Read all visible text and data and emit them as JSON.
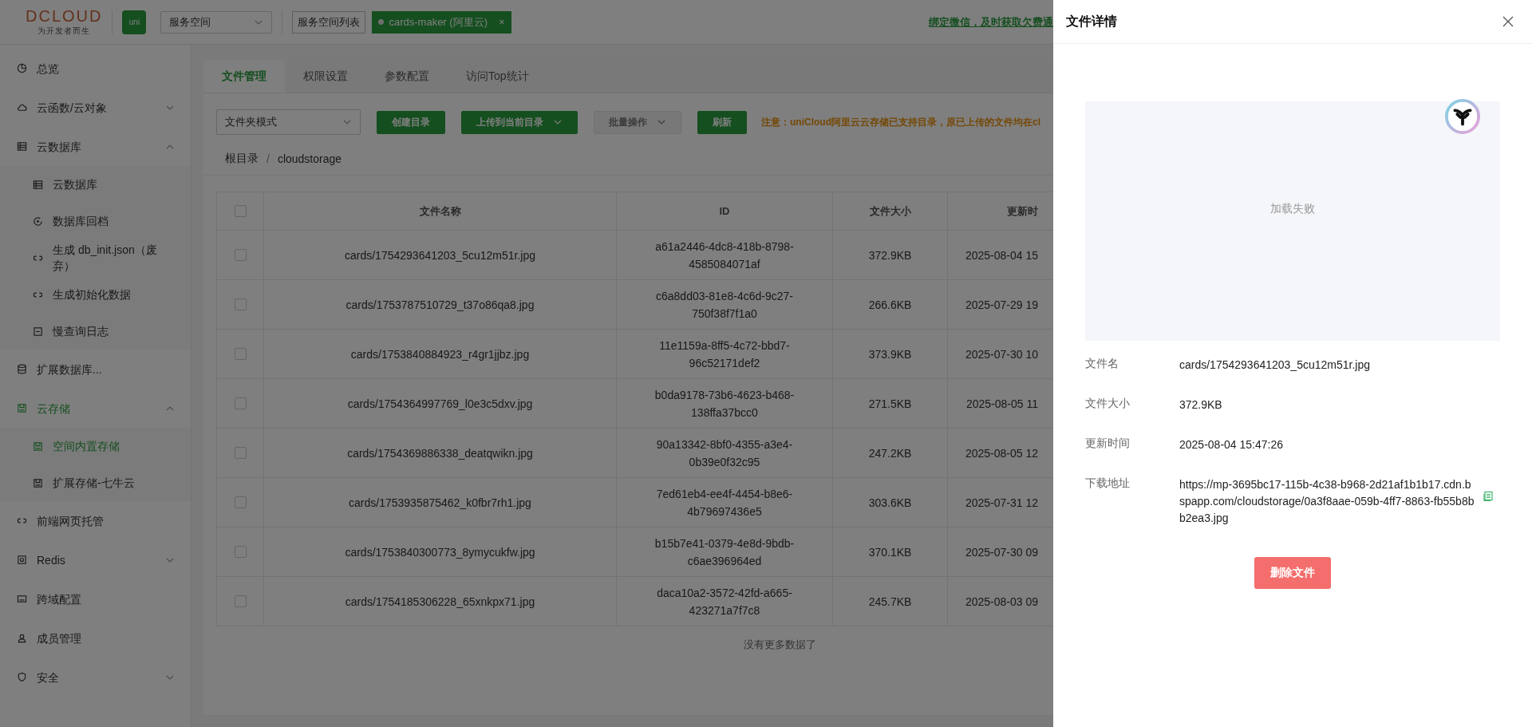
{
  "header": {
    "logo": {
      "name": "DCLOUD",
      "slogan": "为开发者而生"
    },
    "app_badge": "uni",
    "space_select": {
      "value": "服务空间"
    },
    "space_list_button": "服务空间列表",
    "space_tag": {
      "label": "cards-maker (阿里云)",
      "close": "×"
    },
    "notice_link": "绑定微信，及时获取欠费通"
  },
  "sidebar": {
    "items": [
      {
        "label": "总览",
        "selected": false
      },
      {
        "label": "云函数/云对象",
        "selected": false,
        "expanded": false
      },
      {
        "label": "云数据库",
        "selected": false,
        "expanded": true,
        "children": [
          {
            "label": "云数据库",
            "selected": false
          },
          {
            "label": "数据库回档",
            "selected": false
          },
          {
            "label": "生成 db_init.json（废弃）",
            "selected": false
          },
          {
            "label": "生成初始化数据",
            "selected": false
          },
          {
            "label": "慢查询日志",
            "selected": false
          }
        ]
      },
      {
        "label": "扩展数据库...",
        "selected": false
      },
      {
        "label": "云存储",
        "selected": false,
        "expanded": true,
        "children": [
          {
            "label": "空间内置存储",
            "selected": true
          },
          {
            "label": "扩展存储-七牛云",
            "selected": false
          }
        ]
      },
      {
        "label": "前端网页托管",
        "selected": false
      },
      {
        "label": "Redis",
        "selected": false,
        "expanded": false
      },
      {
        "label": "跨域配置",
        "selected": false
      },
      {
        "label": "成员管理",
        "selected": false
      },
      {
        "label": "安全",
        "selected": false,
        "expanded": false
      }
    ]
  },
  "tabs": [
    {
      "label": "文件管理",
      "selected": true
    },
    {
      "label": "权限设置",
      "selected": false
    },
    {
      "label": "参数配置",
      "selected": false
    },
    {
      "label": "访问Top统计",
      "selected": false
    }
  ],
  "toolbar": {
    "mode_select": {
      "value": "文件夹模式"
    },
    "buttons": [
      {
        "label": "创建目录",
        "kind": "plain",
        "disabled": false
      },
      {
        "label": "上传到当前目录",
        "kind": "dropdown",
        "disabled": false
      },
      {
        "label": "批量操作",
        "kind": "dropdown",
        "disabled": true
      },
      {
        "label": "刷新",
        "kind": "plain",
        "disabled": false
      }
    ],
    "notice": "注意：uniCloud阿里云云存储已支持目录，原已上传的文件均在cl"
  },
  "breadcrumb": {
    "items": [
      "根目录",
      "cloudstorage"
    ],
    "separator": "/"
  },
  "table": {
    "select_all": {
      "checked": false
    },
    "columns": [
      "文件名称",
      "ID",
      "文件大小",
      "更新时"
    ],
    "rows": [
      {
        "checked": false,
        "name": "cards/1754293641203_5cu12m51r.jpg",
        "id": "a61a2446-4dc8-418b-8798-4585084071af",
        "size": "372.9KB",
        "time": "2025-08-04 15"
      },
      {
        "checked": false,
        "name": "cards/1753787510729_t37o86qa8.jpg",
        "id": "c6a8dd03-81e8-4c6d-9c27-750f38f7f1a0",
        "size": "266.6KB",
        "time": "2025-07-29 19"
      },
      {
        "checked": false,
        "name": "cards/1753840884923_r4gr1jjbz.jpg",
        "id": "11e1159a-8ff5-4c72-bbd7-96c52171def2",
        "size": "373.9KB",
        "time": "2025-07-30 10"
      },
      {
        "checked": false,
        "name": "cards/1754364997769_l0e3c5dxv.jpg",
        "id": "b0da9178-73b6-4623-b468-138ffa37bcc0",
        "size": "271.5KB",
        "time": "2025-08-05 11"
      },
      {
        "checked": false,
        "name": "cards/1754369886338_deatqwikn.jpg",
        "id": "90a13342-8bf0-4355-a3e4-0b39e0f32c95",
        "size": "247.2KB",
        "time": "2025-08-05 12"
      },
      {
        "checked": false,
        "name": "cards/1753935875462_k0fbr7rh1.jpg",
        "id": "7ed61eb4-ee4f-4454-b8e6-4b79697436e5",
        "size": "303.6KB",
        "time": "2025-07-31 12"
      },
      {
        "checked": false,
        "name": "cards/1753840300773_8ymycukfw.jpg",
        "id": "b15b7e41-0379-4e8d-9bdb-c6ae396964ed",
        "size": "370.1KB",
        "time": "2025-07-30 09"
      },
      {
        "checked": false,
        "name": "cards/1754185306228_65xnkpx71.jpg",
        "id": "daca10a2-3572-42fd-a665-423271a7f7c8",
        "size": "245.7KB",
        "time": "2025-08-03 09"
      }
    ],
    "footer": "没有更多数据了"
  },
  "drawer": {
    "title": "文件详情",
    "preview": {
      "message": "加载失败"
    },
    "fields": [
      {
        "kind": "text",
        "label": "文件名",
        "value": "cards/1754293641203_5cu12m51r.jpg"
      },
      {
        "kind": "text",
        "label": "文件大小",
        "value": "372.9KB"
      },
      {
        "kind": "text",
        "label": "更新时间",
        "value": "2025-08-04 15:47:26"
      },
      {
        "kind": "url",
        "label": "下载地址",
        "value": "https://mp-3695bc17-115b-4c38-b968-2d21af1b1b17.cdn.bspapp.com/cloudstorage/0a3f8aae-059b-4ff7-8863-fb55b8bb2ea3.jpg"
      }
    ],
    "delete_button": "删除文件"
  }
}
